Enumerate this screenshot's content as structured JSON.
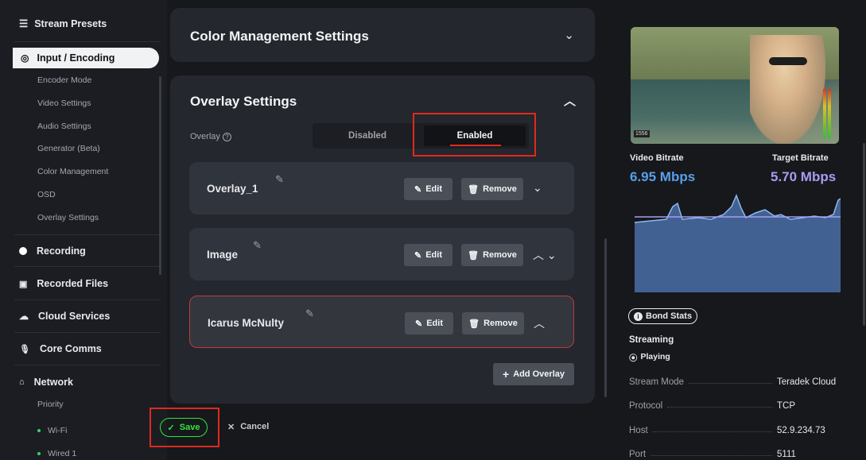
{
  "sidebar": {
    "header": {
      "label": "Stream Presets",
      "icon": "list-icon"
    },
    "active": {
      "label": "Input / Encoding",
      "icon": "broadcast-icon"
    },
    "sub_items": [
      "Encoder Mode",
      "Video Settings",
      "Audio Settings",
      "Generator (Beta)",
      "Color Management",
      "OSD",
      "Overlay Settings"
    ],
    "main_items": [
      {
        "label": "Recording",
        "icon": "record-dot-icon"
      },
      {
        "label": "Recorded Files",
        "icon": "file-icon"
      },
      {
        "label": "Cloud Services",
        "icon": "cloud-icon"
      },
      {
        "label": "Core Comms",
        "icon": "microphone-icon"
      },
      {
        "label": "Network",
        "icon": "network-icon"
      }
    ],
    "network_sub": {
      "priority": "Priority",
      "wifi": "Wi-Fi",
      "wired": "Wired 1"
    }
  },
  "color_card": {
    "title": "Color Management Settings"
  },
  "overlay_card": {
    "title": "Overlay Settings",
    "overlay_label": "Overlay",
    "toggle": {
      "disabled": "Disabled",
      "enabled": "Enabled",
      "selected": "Enabled"
    },
    "items": [
      {
        "name": "Overlay_1",
        "edit": "Edit",
        "remove": "Remove"
      },
      {
        "name": "Image",
        "edit": "Edit",
        "remove": "Remove"
      },
      {
        "name": "Icarus McNulty",
        "edit": "Edit",
        "remove": "Remove"
      }
    ],
    "add_button": "Add Overlay"
  },
  "footer": {
    "save": "Save",
    "cancel": "Cancel"
  },
  "right": {
    "video_timestamp": "1556",
    "video_bitrate_label": "Video Bitrate",
    "video_bitrate_value": "6.95 Mbps",
    "target_bitrate_label": "Target Bitrate",
    "target_bitrate_value": "5.70 Mbps",
    "bond_stats": "Bond Stats",
    "streaming_label": "Streaming",
    "playing_label": "Playing",
    "stats": [
      {
        "key": "Stream Mode",
        "value": "Teradek Cloud"
      },
      {
        "key": "Protocol",
        "value": "TCP"
      },
      {
        "key": "Host",
        "value": "52.9.234.73"
      },
      {
        "key": "Port",
        "value": "5111"
      }
    ]
  },
  "colors": {
    "accent_blue": "#5a9ee9",
    "accent_purple": "#a79cf0",
    "save_green": "#2ee83c",
    "highlight_red": "#e0291d"
  }
}
